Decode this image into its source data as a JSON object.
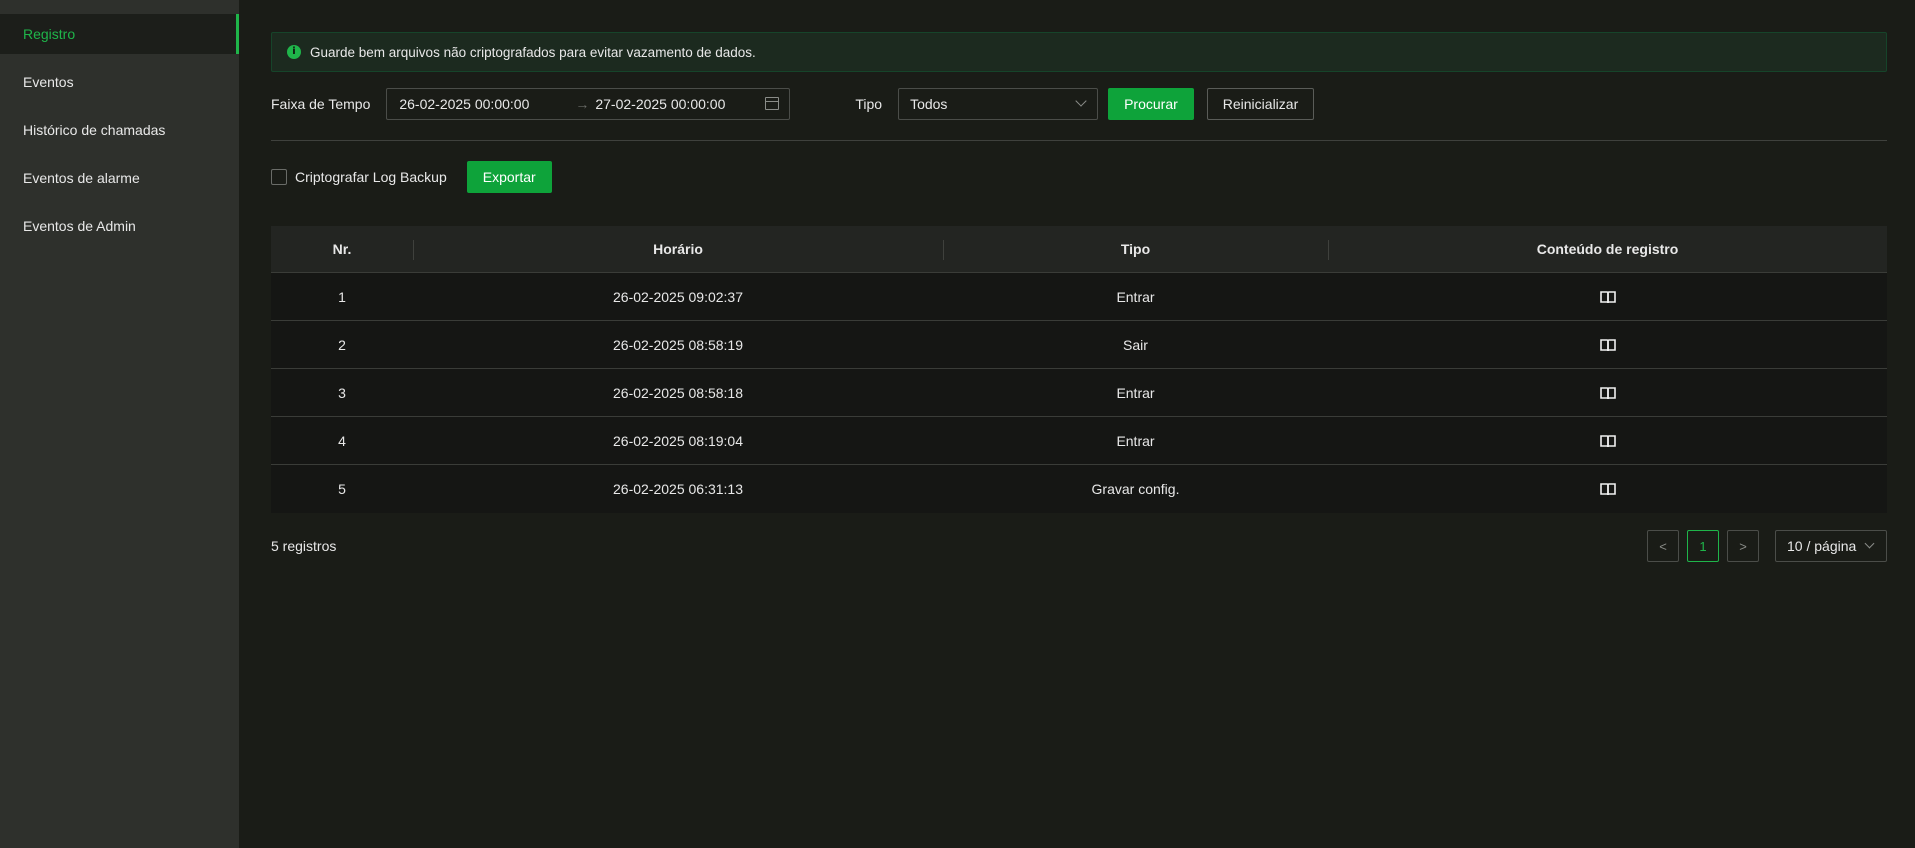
{
  "sidebar": {
    "items": [
      {
        "label": "Registro",
        "active": true
      },
      {
        "label": "Eventos"
      },
      {
        "label": "Histórico de chamadas"
      },
      {
        "label": "Eventos de alarme"
      },
      {
        "label": "Eventos de Admin"
      }
    ]
  },
  "notice": {
    "icon": "info-icon",
    "text": "Guarde bem arquivos não criptografados para evitar vazamento de dados."
  },
  "filters": {
    "time_label": "Faixa de Tempo",
    "start": "26-02-2025 00:00:00",
    "arrow": "→",
    "end": "27-02-2025 00:00:00",
    "type_label": "Tipo",
    "type_value": "Todos",
    "search_label": "Procurar",
    "reset_label": "Reinicializar"
  },
  "export": {
    "checkbox_label": "Criptografar Log Backup",
    "button_label": "Exportar"
  },
  "table": {
    "headers": [
      "Nr.",
      "Horário",
      "Tipo",
      "Conteúdo de registro"
    ],
    "rows": [
      {
        "nr": "1",
        "time": "26-02-2025 09:02:37",
        "type": "Entrar"
      },
      {
        "nr": "2",
        "time": "26-02-2025 08:58:19",
        "type": "Sair"
      },
      {
        "nr": "3",
        "time": "26-02-2025 08:58:18",
        "type": "Entrar"
      },
      {
        "nr": "4",
        "time": "26-02-2025 08:19:04",
        "type": "Entrar"
      },
      {
        "nr": "5",
        "time": "26-02-2025 06:31:13",
        "type": "Gravar config."
      }
    ]
  },
  "footer": {
    "total": "5 registros",
    "prev": "<",
    "page": "1",
    "next": ">",
    "page_size": "10 / página"
  },
  "colors": {
    "accent": "#1fb54a",
    "button_green": "#0ea33a",
    "background": "#1a1c17",
    "sidebar": "#2e302c"
  }
}
